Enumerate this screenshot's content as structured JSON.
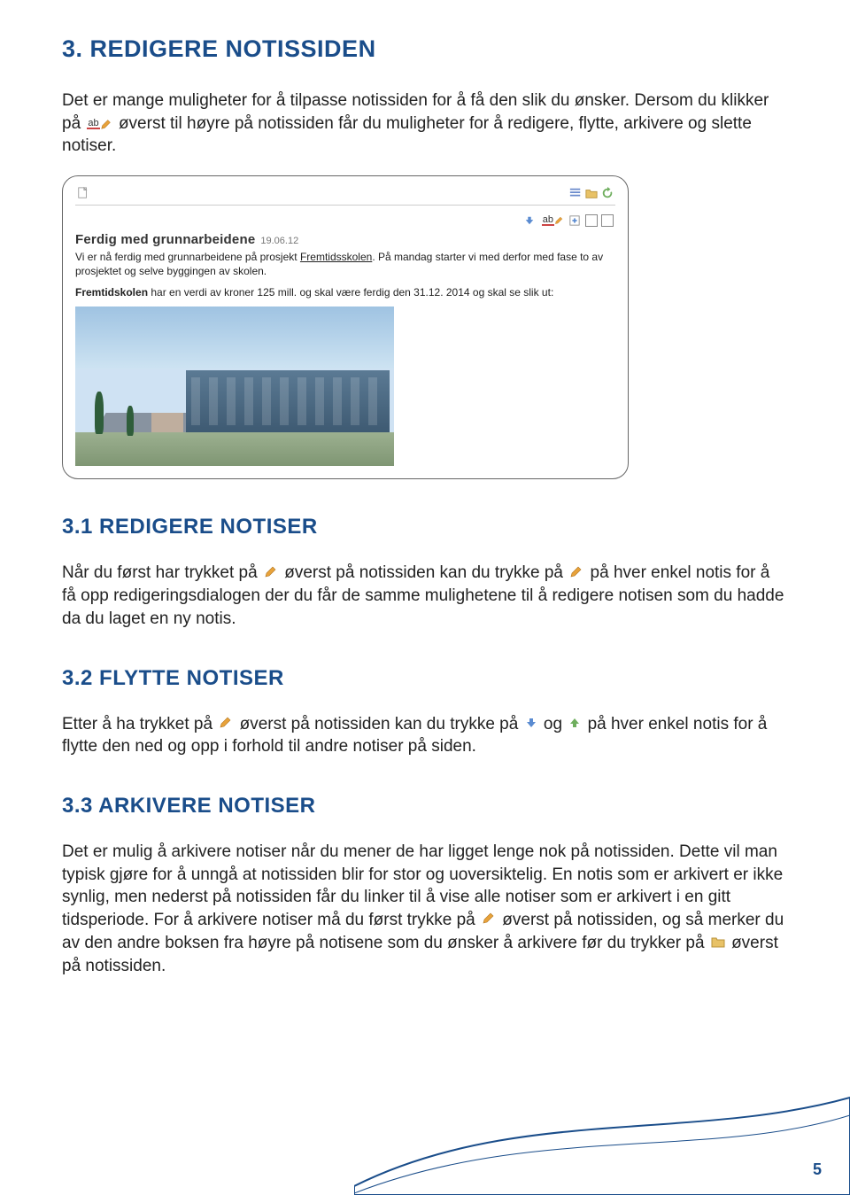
{
  "heading_main": "3. REDIGERE NOTISSIDEN",
  "para1_a": "Det er mange muligheter for å tilpasse notissiden for å få den slik du ønsker. Dersom du klikker på ",
  "para1_b": " øverst til høyre på notissiden får du muligheter for å redigere, flytte, arkivere og slette notiser.",
  "screenshot": {
    "title": "Ferdig med grunnarbeidene",
    "date": "19.06.12",
    "body1_a": "Vi er nå ferdig med grunnarbeidene på prosjekt ",
    "body1_link": "Fremtidsskolen",
    "body1_b": ". På mandag starter vi med derfor med fase to av prosjektet og selve byggingen av skolen.",
    "body2_a": "Fremtidskolen",
    "body2_b": " har en verdi av kroner 125 mill. og skal være ferdig den 31.12. 2014 og skal se slik ut:"
  },
  "heading_31": "3.1 REDIGERE NOTISER",
  "para31_a": "Når du først har trykket på ",
  "para31_b": " øverst på notissiden kan du trykke på ",
  "para31_c": " på hver enkel notis for å få opp redigeringsdialogen der du får de samme mulighetene til å redigere notisen som du hadde da du laget en ny notis.",
  "heading_32": "3.2 FLYTTE NOTISER",
  "para32_a": "Etter å ha trykket på ",
  "para32_b": " øverst på notissiden kan du trykke på ",
  "para32_c": " og ",
  "para32_d": " på hver enkel notis for å flytte den ned og opp i forhold til andre notiser på siden.",
  "heading_33": "3.3 ARKIVERE NOTISER",
  "para33_a": "Det er mulig å arkivere notiser når du mener de har ligget lenge nok på notissiden. Dette vil man typisk gjøre for å unngå at notissiden blir for stor og uoversiktelig. En notis som er arkivert er ikke synlig, men nederst på notissiden får du linker til å vise alle notiser som er arkivert i en gitt tidsperiode. For å arkivere notiser må du først trykke på ",
  "para33_b": " øverst på notissiden, og så merker du av den andre boksen fra høyre på notisene som du ønsker å arkivere før du trykker på ",
  "para33_c": " øverst på notissiden.",
  "page_number": "5",
  "icons": {
    "ab_label": "ab"
  }
}
